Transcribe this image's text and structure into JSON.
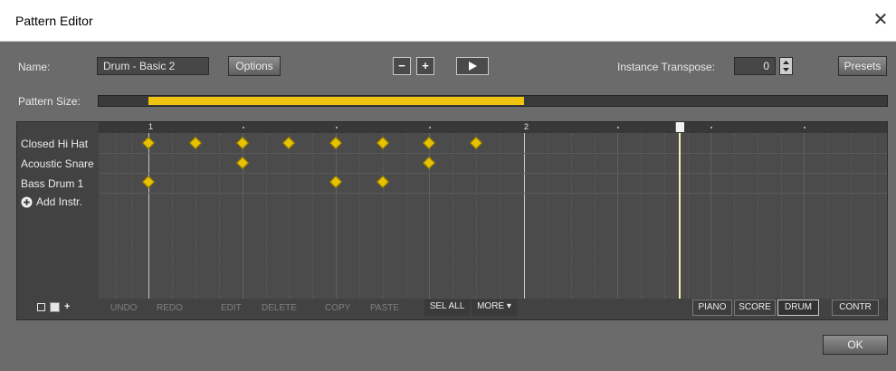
{
  "window": {
    "title": "Pattern Editor",
    "close_glyph": "✕"
  },
  "header": {
    "name_label": "Name:",
    "name_value": "Drum - Basic 2",
    "options_label": "Options",
    "minus_glyph": "−",
    "plus_glyph": "+",
    "transpose_label": "Instance Transpose:",
    "transpose_value": "0",
    "presets_label": "Presets"
  },
  "pattern_size": {
    "label": "Pattern Size:",
    "fill_fraction_start": 0.063,
    "fill_fraction_end": 0.54
  },
  "ruler": {
    "bar_labels": [
      "1",
      "2"
    ]
  },
  "instruments": {
    "items": [
      "Closed Hi Hat",
      "Acoustic Snare",
      "Bass Drum 1"
    ],
    "add_label": "Add Instr."
  },
  "toolbar": {
    "undo": "UNDO",
    "redo": "REDO",
    "edit": "EDIT",
    "delete": "DELETE",
    "copy": "COPY",
    "paste": "PASTE",
    "sel_all": "SEL ALL",
    "more": "MORE ▾",
    "piano": "PIANO",
    "score": "SCORE",
    "drum": "DRUM",
    "contr": "CONTR"
  },
  "footer": {
    "ok_label": "OK"
  },
  "colors": {
    "note": "#e6c200",
    "size_fill": "#f1c40f",
    "background": "#6b6b6b"
  },
  "icons": [
    "close-icon",
    "play-icon",
    "spinner-icon",
    "add-circle-icon",
    "new-icon",
    "select-icon"
  ]
}
